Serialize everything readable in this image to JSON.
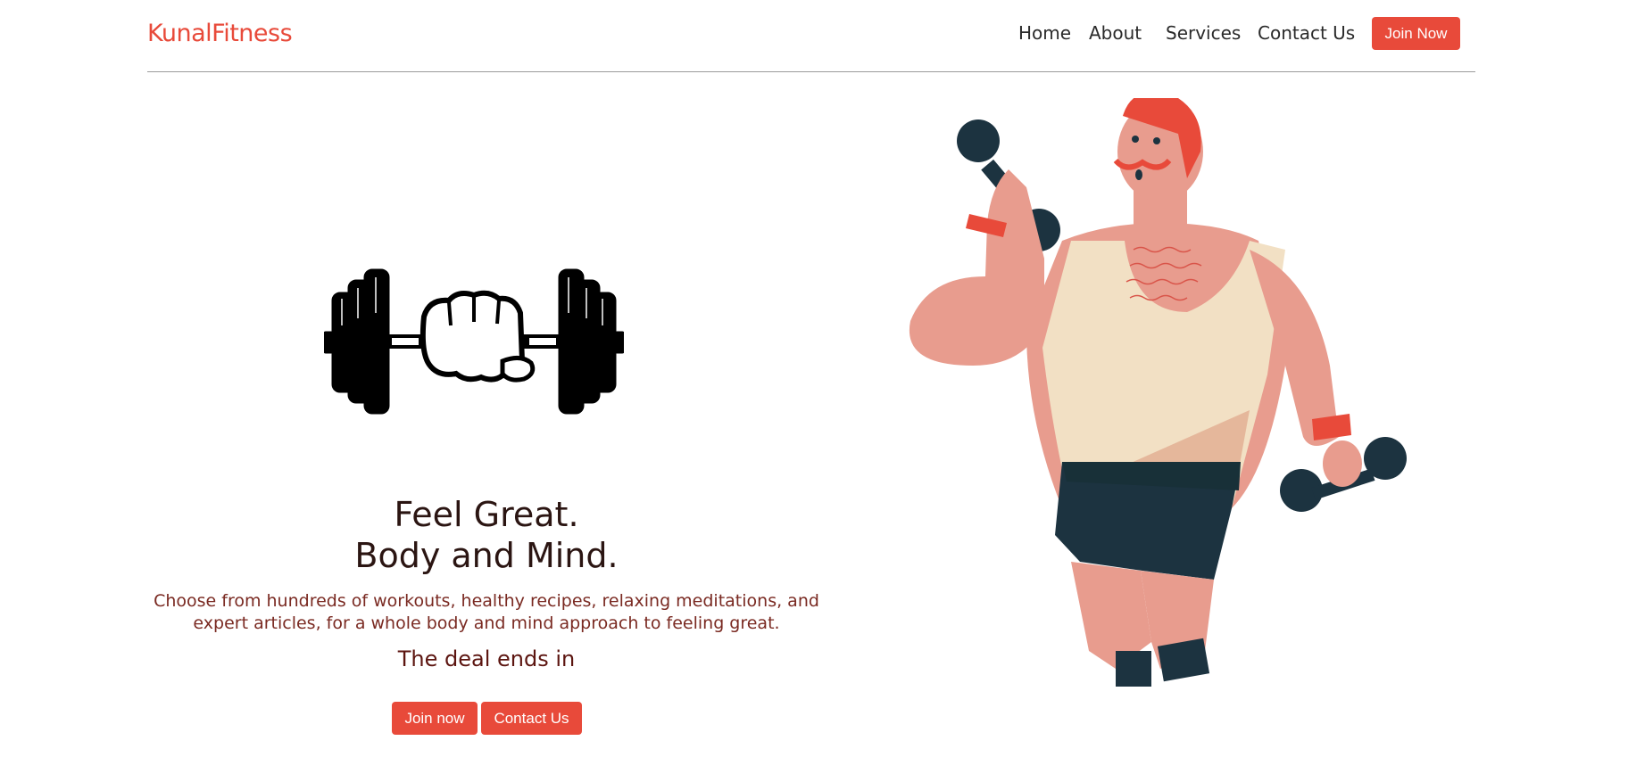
{
  "nav": {
    "brand": "KunalFitness",
    "links": [
      "Home",
      "About",
      "Services",
      "Contact Us"
    ],
    "join_button": "Join Now"
  },
  "hero": {
    "headline_line1": "Feel Great.",
    "headline_line2": "Body and Mind.",
    "description": "Choose from hundreds of workouts, healthy recipes, relaxing meditations, and expert articles, for a whole body and mind approach to feeling great.",
    "deal_text": "The deal ends in",
    "join_button": "Join now",
    "contact_button": "Contact Us"
  },
  "colors": {
    "accent": "#e84a3a",
    "headline": "#2b1512",
    "text": "#7a2a22"
  },
  "icons": [
    "dumbbell-fist-icon",
    "man-lifting-dumbbells-illustration"
  ]
}
